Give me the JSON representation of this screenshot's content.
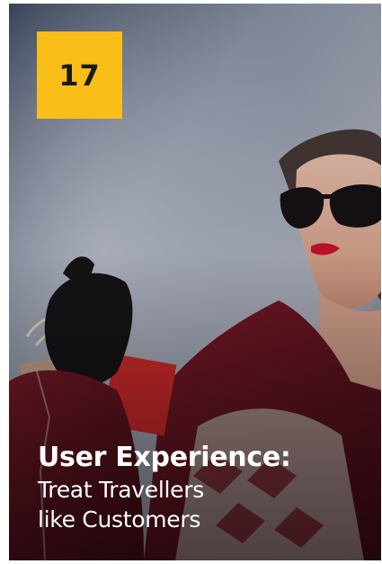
{
  "card": {
    "number": "17",
    "headline": "User Experience:",
    "subline_1": "Treat Travellers",
    "subline_2": "like Customers"
  },
  "colors": {
    "badge": "#f9be17",
    "title_text": "#ffffff",
    "number_text": "#1a1a1a"
  }
}
